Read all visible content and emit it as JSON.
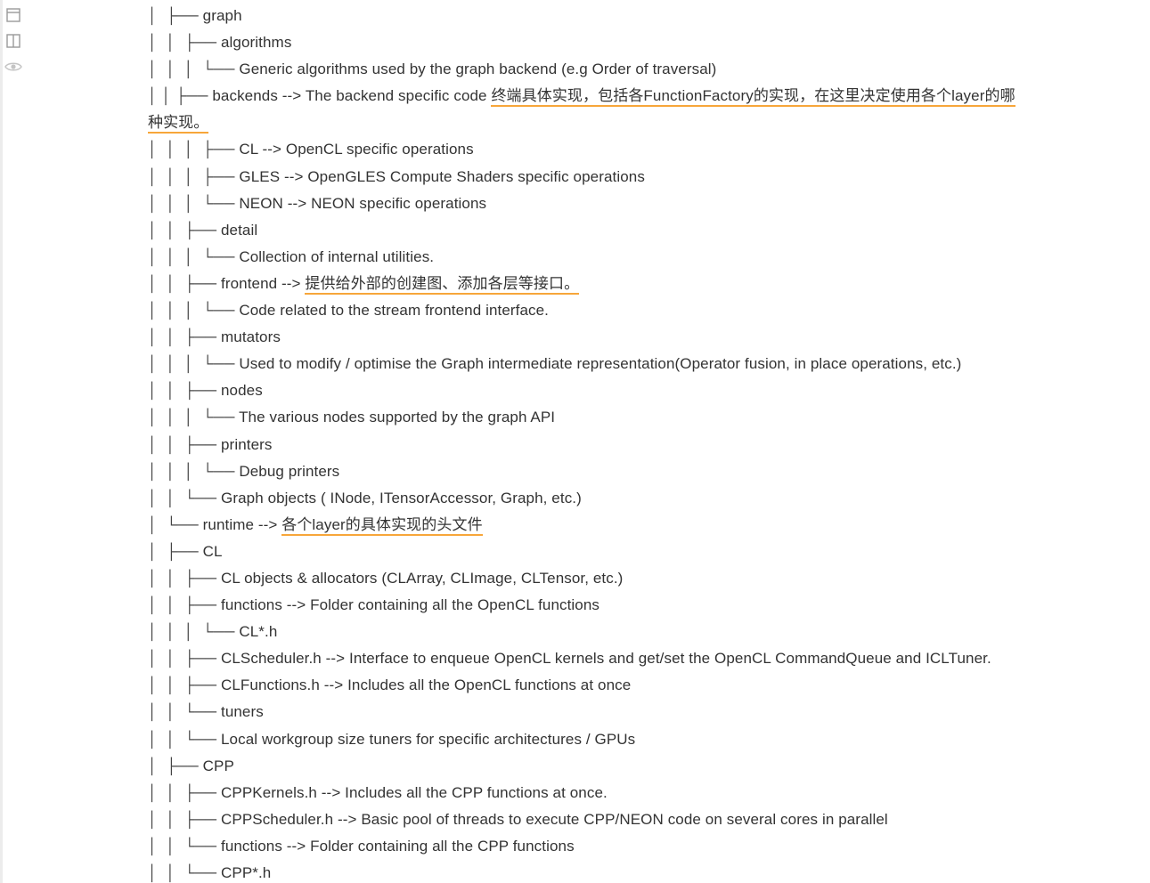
{
  "toolbar": {
    "icons": [
      "outline-panel-icon",
      "split-view-icon",
      "preview-eye-icon"
    ]
  },
  "accent_color": "#f7a63a",
  "tree": [
    {
      "prefix": "│  ├── ",
      "text": "graph",
      "note": ""
    },
    {
      "prefix": "│  │  ├── ",
      "text": "algorithms",
      "note": ""
    },
    {
      "prefix": "│  │  │  └── ",
      "text": "Generic algorithms used by the graph backend (e.g Order of traversal)",
      "note": ""
    },
    {
      "prefix": "│  │  ├── ",
      "text": "backends --> The backend specific code ",
      "note": "终端具体实现，包括各FunctionFactory的实现，在这里决定使用各个layer的哪种实现。"
    },
    {
      "prefix": "│  │  │  ├── ",
      "text": "CL --> OpenCL specific operations",
      "note": ""
    },
    {
      "prefix": "│  │  │  ├── ",
      "text": "GLES --> OpenGLES Compute Shaders specific operations",
      "note": ""
    },
    {
      "prefix": "│  │  │  └── ",
      "text": "NEON --> NEON specific operations",
      "note": ""
    },
    {
      "prefix": "│  │  ├── ",
      "text": "detail",
      "note": ""
    },
    {
      "prefix": "│  │  │  └── ",
      "text": "Collection of internal utilities.",
      "note": ""
    },
    {
      "prefix": "│  │  ├── ",
      "text": "frontend --> ",
      "note": "提供给外部的创建图、添加各层等接口。"
    },
    {
      "prefix": "│  │  │  └── ",
      "text": "Code related to the stream frontend interface.",
      "note": ""
    },
    {
      "prefix": "│  │  ├── ",
      "text": "mutators",
      "note": ""
    },
    {
      "prefix": "│  │  │  └── ",
      "text": "Used to modify / optimise the Graph intermediate representation(Operator fusion, in place operations, etc.)",
      "note": ""
    },
    {
      "prefix": "│  │  ├── ",
      "text": "nodes",
      "note": ""
    },
    {
      "prefix": "│  │  │  └── ",
      "text": "The various nodes supported by the graph API",
      "note": ""
    },
    {
      "prefix": "│  │  ├── ",
      "text": "printers",
      "note": ""
    },
    {
      "prefix": "│  │  │  └── ",
      "text": "Debug printers",
      "note": ""
    },
    {
      "prefix": "│  │  └── ",
      "text": "Graph objects ( INode, ITensorAccessor, Graph, etc.)",
      "note": ""
    },
    {
      "prefix": "│  └── ",
      "text": "runtime --> ",
      "note": "各个layer的具体实现的头文件"
    },
    {
      "prefix": "│  ├── ",
      "text": "CL",
      "note": ""
    },
    {
      "prefix": "│  │  ├── ",
      "text": "CL objects & allocators (CLArray, CLImage, CLTensor, etc.)",
      "note": ""
    },
    {
      "prefix": "│  │  ├── ",
      "text": "functions --> Folder containing all the OpenCL functions",
      "note": ""
    },
    {
      "prefix": "│  │  │  └── ",
      "text": "CL*.h",
      "note": ""
    },
    {
      "prefix": "│  │  ├── ",
      "text": "CLScheduler.h --> Interface to enqueue OpenCL kernels and get/set the OpenCL CommandQueue and ICLTuner.",
      "note": ""
    },
    {
      "prefix": "│  │  ├── ",
      "text": "CLFunctions.h --> Includes all the OpenCL functions at once",
      "note": ""
    },
    {
      "prefix": "│  │  └── ",
      "text": "tuners",
      "note": ""
    },
    {
      "prefix": "│  │  └── ",
      "text": "Local workgroup size tuners for specific architectures / GPUs",
      "note": ""
    },
    {
      "prefix": "│  ├── ",
      "text": "CPP",
      "note": ""
    },
    {
      "prefix": "│  │  ├── ",
      "text": "CPPKernels.h --> Includes all the CPP functions at once.",
      "note": ""
    },
    {
      "prefix": "│  │  ├── ",
      "text": "CPPScheduler.h --> Basic pool of threads to execute CPP/NEON code on several cores in parallel",
      "note": ""
    },
    {
      "prefix": "│  │  └── ",
      "text": "functions --> Folder containing all the CPP functions",
      "note": ""
    },
    {
      "prefix": "│  │  └── ",
      "text": "CPP*.h",
      "note": ""
    }
  ]
}
